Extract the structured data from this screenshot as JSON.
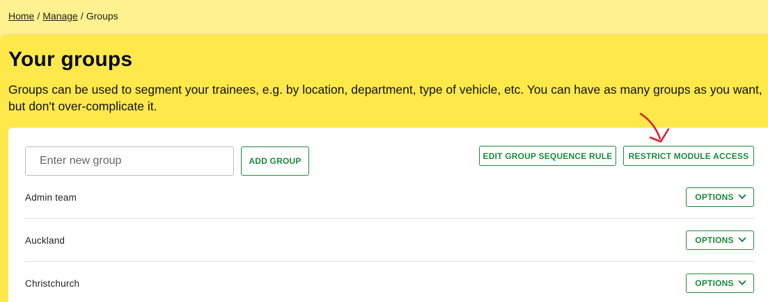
{
  "breadcrumb": {
    "home": "Home",
    "sep1": "/",
    "manage": "Manage",
    "sep2": "/",
    "current": "Groups"
  },
  "header": {
    "title": "Your groups",
    "description": "Groups can be used to segment your trainees, e.g. by location, department, type of vehicle, etc. You can have as many groups as you want, but don't over-complicate it."
  },
  "toolbar": {
    "new_group_placeholder": "Enter new group",
    "add_label": "ADD GROUP",
    "sequence_label": "EDIT GROUP SEQUENCE RULE",
    "restrict_label": "RESTRICT MODULE ACCESS"
  },
  "groups": [
    {
      "name": "Admin team",
      "options_label": "OPTIONS"
    },
    {
      "name": "Auckland",
      "options_label": "OPTIONS"
    },
    {
      "name": "Christchurch",
      "options_label": "OPTIONS"
    }
  ],
  "colors": {
    "page_bg": "#fff18f",
    "hero_bg": "#ffe94a",
    "accent_green": "#1a8a3a",
    "annotation_red": "#e0202a"
  },
  "icons": {
    "options_chevron": "chevron-down-icon",
    "annotation": "red-arrow-annotation"
  }
}
